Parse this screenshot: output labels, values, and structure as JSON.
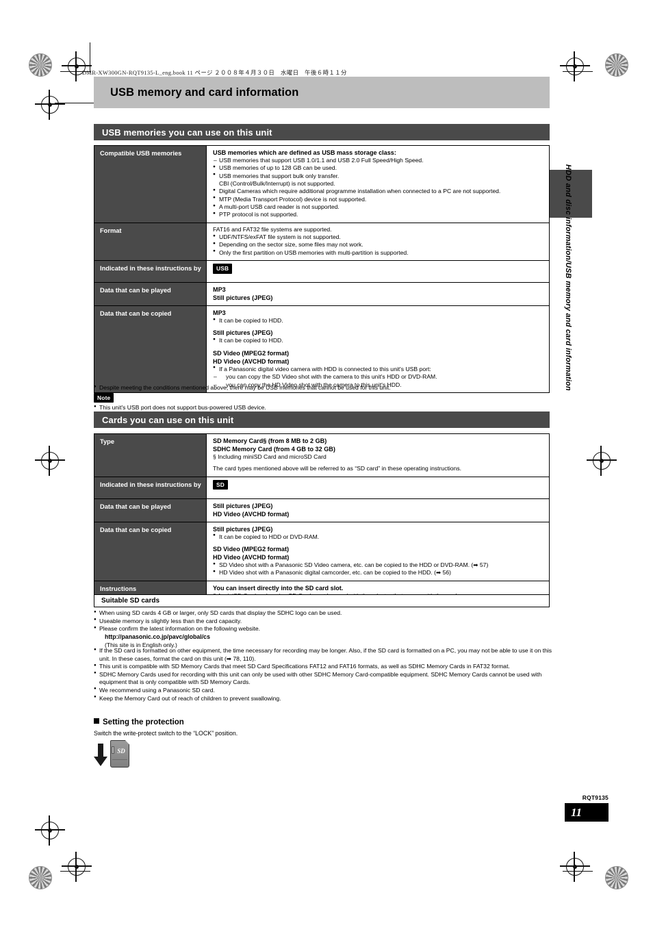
{
  "running_head": "DMR-XW300GN-RQT9135-L_eng.book  11 ページ  ２００８年４月３０日　水曜日　午後６時１１分",
  "chapter_title": "USB memory and card information",
  "side_tab_text": "HDD and disc information/USB memory and card information",
  "footer": {
    "code": "RQT9135",
    "page": "11"
  },
  "usb_section": {
    "heading": "USB memories you can use on this unit",
    "rows": [
      {
        "label": "Compatible USB memories",
        "lead": "USB memories which are defined as USB mass storage class:",
        "dash_items": [
          "USB memories that support USB 1.0/1.1 and USB 2.0 Full Speed/High Speed."
        ],
        "bullets": [
          "USB memories of up to 128 GB can be used.",
          "USB memories that support bulk only transfer.",
          "Digital Cameras which require additional programme installation when connected to a PC are not supported.",
          "MTP (Media Transport Protocol) device is not supported.",
          "A multi-port USB card reader is not supported.",
          "PTP protocol is not supported."
        ],
        "bullet_sub": "CBI (Control/Bulk/Interrupt) is not supported."
      },
      {
        "label": "Format",
        "lead_plain": "FAT16 and FAT32 file systems are supported.",
        "bullets": [
          "UDF/NTFS/exFAT file system is not supported.",
          "Depending on the sector size, some files may not work.",
          "Only the first partition on USB memories with multi-partition is supported."
        ]
      },
      {
        "label": "Indicated in these instructions by",
        "badge": "USB"
      },
      {
        "label": "Data that can be played",
        "lines": [
          "MP3",
          "Still pictures (JPEG)"
        ]
      },
      {
        "label": "Data that can be copied",
        "groups": [
          {
            "title": "MP3",
            "bullets": [
              "It can be copied to HDD."
            ]
          },
          {
            "title": "Still pictures (JPEG)",
            "bullets": [
              "It can be copied to HDD."
            ]
          },
          {
            "title": "SD Video (MPEG2 format)",
            "title2": "HD Video (AVCHD format)",
            "bullets": [
              "If a Panasonic digital video camera with HDD is connected to this unit's USB port:"
            ],
            "dashes": [
              "you can copy the SD Video shot with the camera to this unit's HDD or DVD-RAM.",
              "you can copy the HD Video shot with the camera to this unit's HDD."
            ]
          }
        ]
      }
    ],
    "after_notes": [
      "Despite meeting the conditions mentioned above, there may be USB memories that cannot be used for this unit."
    ],
    "note_badge": "Note",
    "note_bullets": [
      "This unit's USB port does not support bus-powered USB device."
    ]
  },
  "card_section": {
    "heading": "Cards you can use on this unit",
    "rows": [
      {
        "label": "Type",
        "lines": [
          "SD Memory Card§ (from 8 MB to 2 GB)",
          "SDHC Memory Card (from 4 GB to 32 GB)"
        ],
        "footnote": "§  Including miniSD Card and microSD Card",
        "paragraph": "The card types mentioned above will be referred to as “SD card” in these operating instructions."
      },
      {
        "label": "Indicated in these instructions by",
        "badge": "SD"
      },
      {
        "label": "Data that can be played",
        "lines": [
          "Still pictures (JPEG)",
          "HD Video (AVCHD format)"
        ]
      },
      {
        "label": "Data that can be copied",
        "groups": [
          {
            "title": "Still pictures (JPEG)",
            "bullets": [
              "It can be copied to HDD or DVD-RAM."
            ]
          },
          {
            "title": "SD Video (MPEG2 format)",
            "title2": "HD Video (AVCHD format)",
            "bullets": [
              "SD Video shot with a Panasonic SD Video camera, etc. can be copied to the HDD or DVD-RAM. (➡ 57)",
              "HD Video shot with a Panasonic digital camcorder, etc. can be copied to the HDD. (➡ 56)"
            ]
          }
        ]
      },
      {
        "label": "Instructions",
        "lead": "You can insert directly into the SD card slot.",
        "footnote": "§   A miniSD Card and a microSD Card must be used with the adaptor that comes with the card."
      }
    ]
  },
  "suitable": {
    "heading": "Suitable SD cards",
    "bullets_1": [
      "When using SD cards 4 GB or larger, only SD cards that display the SDHC logo can be used.",
      "Useable memory is slightly less than the card capacity.",
      "Please confirm the latest information on the following website."
    ],
    "url": "http://panasonic.co.jp/pavc/global/cs",
    "url_note": "(This site is in English only.)",
    "bullets_2": [
      "If the SD card is formatted on other equipment, the time necessary for recording may be longer. Also, if the SD card is formatted on a PC, you may not be able to use it on this unit. In these cases, format the card on this unit (➡ 78, 110).",
      "This unit is compatible with SD Memory Cards that meet SD Card Specifications FAT12 and FAT16 formats, as well as SDHC Memory Cards in FAT32 format.",
      "SDHC Memory Cards used for recording with this unit can only be used with other SDHC Memory Card-compatible equipment. SDHC Memory Cards cannot be used with equipment that is only compatible with SD Memory Cards.",
      "We recommend using a Panasonic SD card.",
      "Keep the Memory Card out of reach of children to prevent swallowing."
    ]
  },
  "protection": {
    "heading": "Setting the protection",
    "text": "Switch the write-protect switch to the “LOCK” position.",
    "card_logo": "SD"
  }
}
